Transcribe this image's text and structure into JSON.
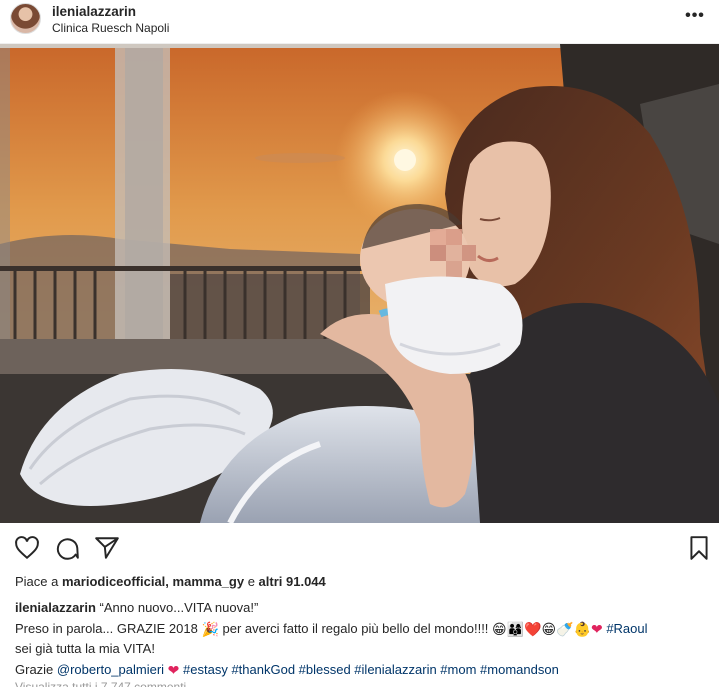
{
  "header": {
    "username": "ilenialazzarin",
    "location": "Clinica Ruesch Napoli",
    "more_icon": "more-horizontal-icon",
    "more_glyph": "•••"
  },
  "photo": {
    "alt": "Mother holding newborn baby by a window at sunset",
    "colors": {
      "sky_top": "#d8772e",
      "sky_mid": "#e9a452",
      "sun": "#fff3cf",
      "shadow": "#2a2420"
    }
  },
  "actions": {
    "like_icon": "heart-outline-icon",
    "comment_icon": "comment-bubble-icon",
    "share_icon": "paper-plane-icon",
    "save_icon": "bookmark-icon"
  },
  "likes": {
    "prefix": "Piace a ",
    "user1": "mariodiceofficial",
    "separator": ", ",
    "user2": "mamma_gy",
    "middle": " e ",
    "others": "altri 91.044"
  },
  "caption": {
    "username": "ilenialazzarin",
    "line1_text": " “Anno nuovo...VITA nuova!”",
    "line2_text": "Preso in parola... GRAZIE 2018 ",
    "line2_emoji1": "🎉",
    "line2_text2": " per averci fatto il regalo più bello del mondo!!!! ",
    "line2_emojis": "😁👨‍👩‍👦❤️😁🍼👶",
    "line2_heart": "❤",
    "line2_tag": "#Raoul",
    "line3_text": "sei già tutta la mia VITA!",
    "line4_text": "Grazie ",
    "line4_mention": "@roberto_palmieri",
    "line4_heart": "❤",
    "line4_tags": "#estasy #thankGod #blessed #ilenialazzarin #mom #momandson",
    "faded_line": "Visualizza tutti i 7.747 commenti"
  },
  "colors": {
    "link": "#003569",
    "heart": "#e0245e",
    "text": "#262626",
    "border": "#efefef"
  }
}
